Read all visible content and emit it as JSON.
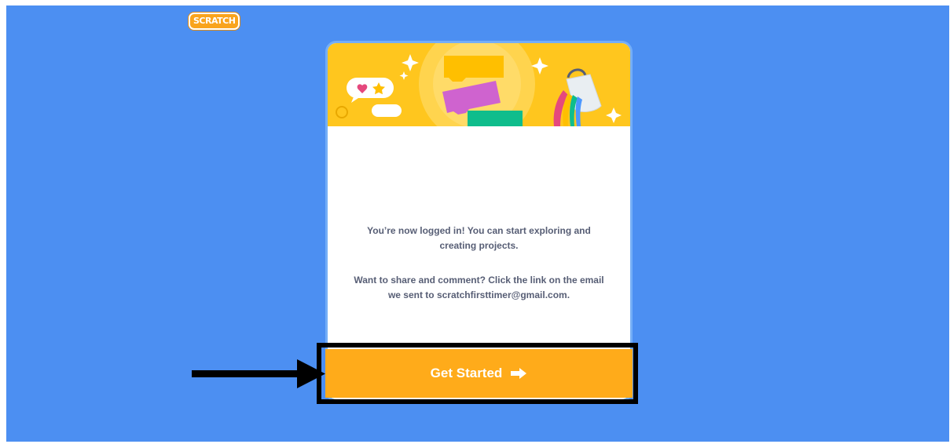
{
  "logo": {
    "text": "SCRATCH"
  },
  "card": {
    "message_1": "You’re now logged in! You can start exploring and creating projects.",
    "message_2": "Want to share and comment? Click the link on the email we sent to scratchfirsttimer@gmail.com."
  },
  "button": {
    "label": "Get Started"
  },
  "colors": {
    "background": "#4c8ff2",
    "header": "#ffc61e",
    "button": "#ffab1a",
    "text": "#575e75"
  },
  "icons": [
    "arrow-right-icon",
    "heart-icon",
    "star-icon",
    "paint-bucket-icon",
    "sparkle-icon"
  ]
}
